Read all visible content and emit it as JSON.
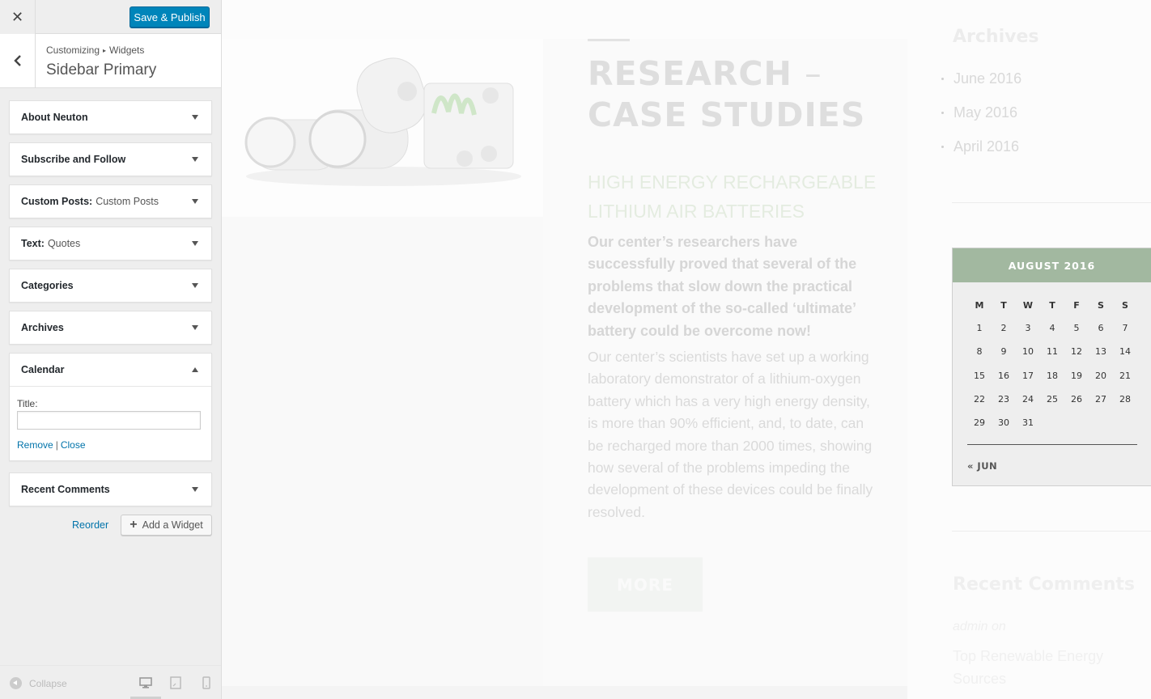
{
  "topbar": {
    "close_icon": "close-icon",
    "save_label": "Save & Publish"
  },
  "section": {
    "breadcrumb": [
      "Customizing",
      "Widgets"
    ],
    "title": "Sidebar Primary"
  },
  "widgets": [
    {
      "title": "About Neuton",
      "subtitle": ""
    },
    {
      "title": "Subscribe and Follow",
      "subtitle": ""
    },
    {
      "title": "Custom Posts:",
      "subtitle": "Custom Posts"
    },
    {
      "title": "Text:",
      "subtitle": "Quotes"
    },
    {
      "title": "Categories",
      "subtitle": ""
    },
    {
      "title": "Archives",
      "subtitle": ""
    },
    {
      "title": "Calendar",
      "subtitle": "",
      "expanded": true,
      "field_label": "Title:",
      "field_value": "",
      "remove_label": "Remove",
      "separator": "|",
      "close_label": "Close"
    },
    {
      "title": "Recent Comments",
      "subtitle": ""
    }
  ],
  "actions": {
    "reorder_label": "Reorder",
    "add_widget_label": "Add a Widget"
  },
  "footer": {
    "collapse_label": "Collapse",
    "devices": [
      "desktop-icon",
      "tablet-icon",
      "mobile-icon"
    ],
    "active_device": "desktop"
  },
  "preview": {
    "post": {
      "title_line1": "RESEARCH",
      "title_dash": "–",
      "title_line2": "CASE STUDIES",
      "subtitle": "HIGH ENERGY RECHARGEABLE LITHIUM AIR BATTERIES",
      "lead": "Our center’s researchers have successfully proved that several of the problems that slow down the practical development of the so-called ‘ultimate’ battery could be overcome now!",
      "body": "Our center’s scientists have set up a working laboratory demonstrator of a lithium-oxygen battery which has a very high energy density, is more than 90% efficient, and, to date, can be recharged more than 2000 times, showing how several of the problems impeding the development of these devices could be finally resolved.",
      "more_label": "MORE"
    },
    "archives": {
      "title": "Archives",
      "items": [
        "June 2016",
        "May 2016",
        "April 2016"
      ]
    },
    "calendar": {
      "month_label": "AUGUST 2016",
      "weekdays": [
        "M",
        "T",
        "W",
        "T",
        "F",
        "S",
        "S"
      ],
      "weeks": [
        [
          "1",
          "2",
          "3",
          "4",
          "5",
          "6",
          "7"
        ],
        [
          "8",
          "9",
          "10",
          "11",
          "12",
          "13",
          "14"
        ],
        [
          "15",
          "16",
          "17",
          "18",
          "19",
          "20",
          "21"
        ],
        [
          "22",
          "23",
          "24",
          "25",
          "26",
          "27",
          "28"
        ],
        [
          "29",
          "30",
          "31",
          "",
          "",
          "",
          ""
        ]
      ],
      "prev_label": "« JUN"
    },
    "recent_comments": {
      "title": "Recent Comments",
      "author": "admin on",
      "link": "Top Renewable Energy Sources"
    }
  },
  "colors": {
    "accent": "#0085ba",
    "calendar_header": "#a2b8a0",
    "link": "#0073aa"
  }
}
